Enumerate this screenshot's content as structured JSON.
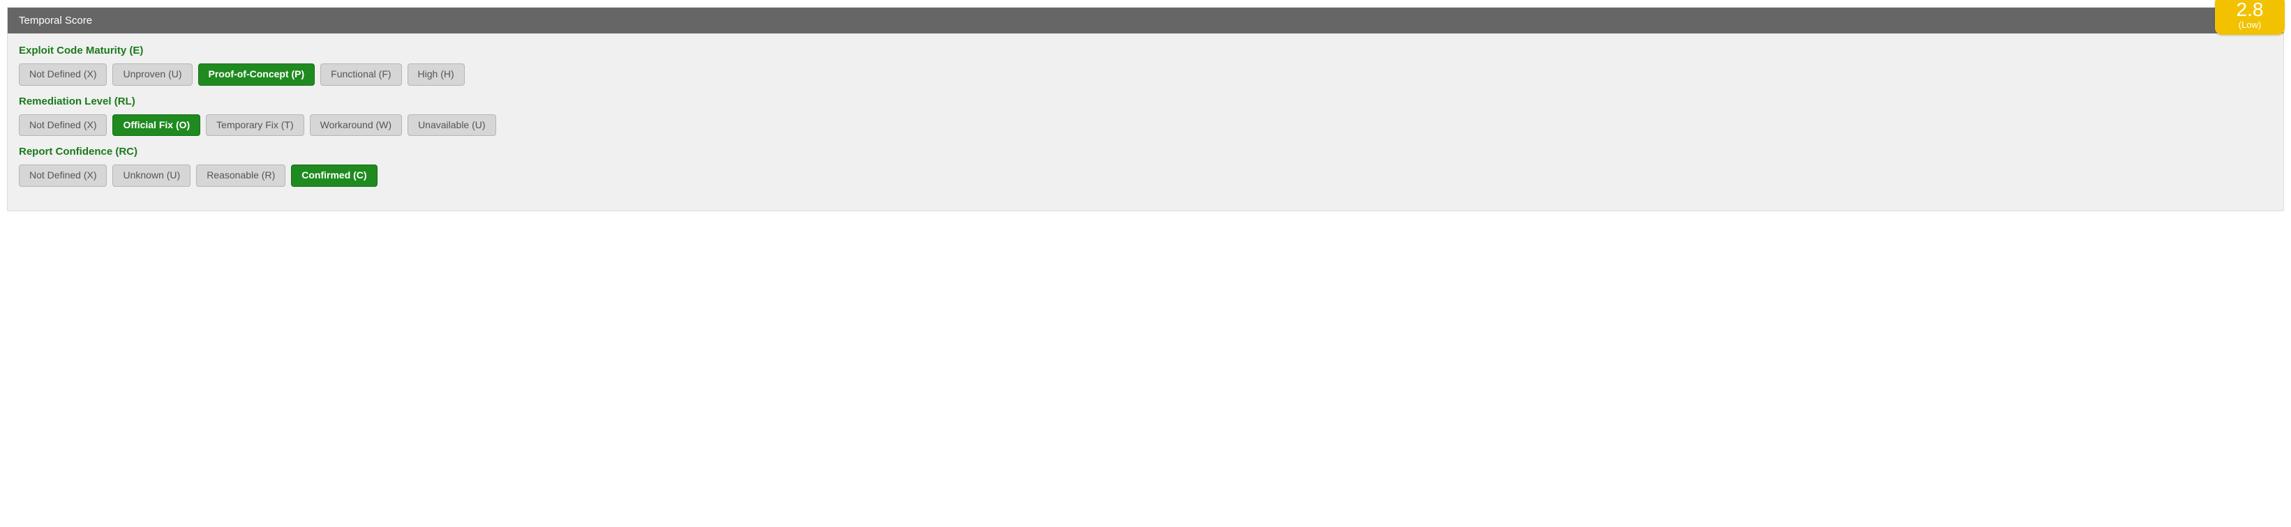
{
  "panel": {
    "title": "Temporal Score",
    "score": {
      "value": "2.8",
      "label": "(Low)",
      "bg": "#f2c200"
    }
  },
  "metrics": [
    {
      "id": "exploit-code-maturity",
      "title": "Exploit Code Maturity (E)",
      "selectedIndex": 2,
      "options": [
        "Not Defined (X)",
        "Unproven (U)",
        "Proof-of-Concept (P)",
        "Functional (F)",
        "High (H)"
      ]
    },
    {
      "id": "remediation-level",
      "title": "Remediation Level (RL)",
      "selectedIndex": 1,
      "options": [
        "Not Defined (X)",
        "Official Fix (O)",
        "Temporary Fix (T)",
        "Workaround (W)",
        "Unavailable (U)"
      ]
    },
    {
      "id": "report-confidence",
      "title": "Report Confidence (RC)",
      "selectedIndex": 3,
      "options": [
        "Not Defined (X)",
        "Unknown (U)",
        "Reasonable (R)",
        "Confirmed (C)"
      ]
    }
  ]
}
